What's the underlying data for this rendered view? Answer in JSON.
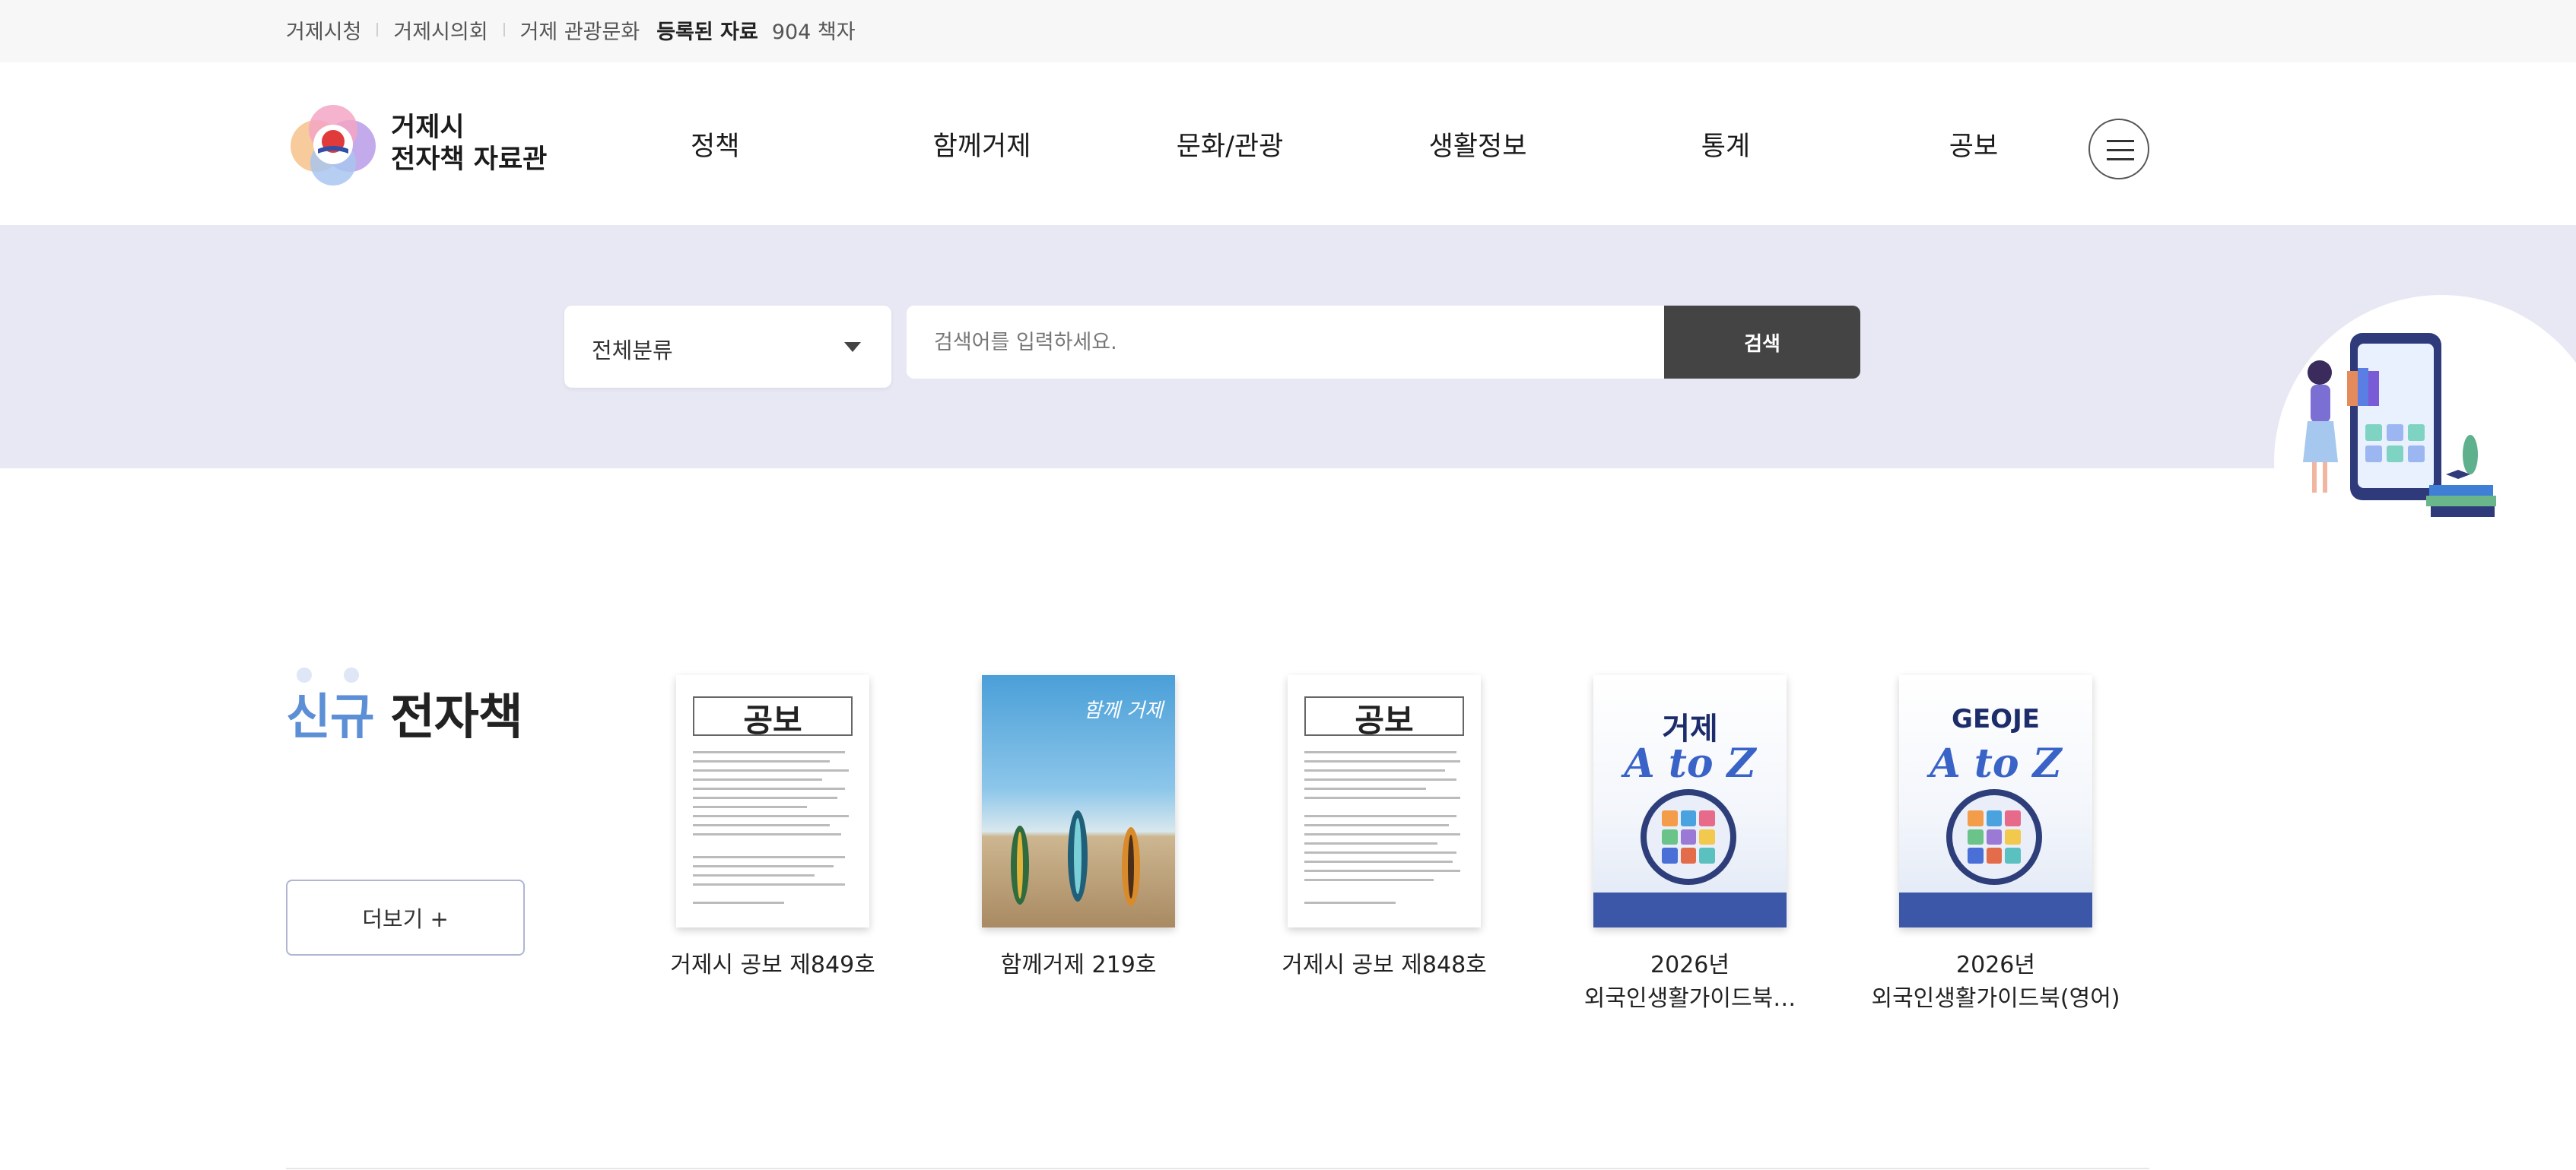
{
  "topbar": {
    "links": [
      "거제시청",
      "거제시의회",
      "거제 관광문화"
    ],
    "registered_label": "등록된 자료",
    "registered_count": "904 책자"
  },
  "header": {
    "logo_line1": "거제시",
    "logo_line2": "전자책 자료관",
    "nav": [
      "정책",
      "함께거제",
      "문화/관광",
      "생활정보",
      "통계",
      "공보"
    ]
  },
  "search": {
    "category_selected": "전체분류",
    "placeholder": "검색어를 입력하세요.",
    "button_label": "검색"
  },
  "new_books": {
    "title_accent": "신규",
    "title_rest": " 전자책",
    "more_label": "더보기 +",
    "books": [
      {
        "line1": "거제시 공보 제849호",
        "line2": ""
      },
      {
        "line1": "함께거제 219호",
        "line2": ""
      },
      {
        "line1": "거제시 공보 제848호",
        "line2": ""
      },
      {
        "line1": "2026년",
        "line2": "외국인생활가이드북…"
      },
      {
        "line1": "2026년",
        "line2": "외국인생활가이드북(영어)"
      }
    ],
    "covers": {
      "gongbo": "공보",
      "atoz_ko": "거제",
      "atoz_en": "GEOJE",
      "atoz_sub": "A to Z",
      "magazine_script": "함께 거제"
    }
  },
  "colors": {
    "accent": "#5c8fd6",
    "search_band": "#e8e8f4",
    "search_button": "#444444"
  }
}
